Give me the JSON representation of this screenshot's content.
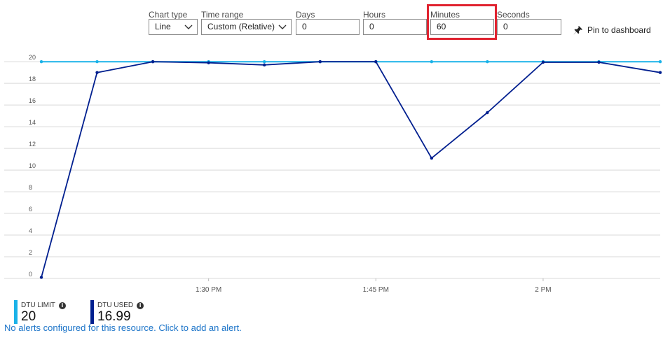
{
  "toolbar": {
    "chart_type": {
      "label": "Chart type",
      "value": "Line"
    },
    "time_range": {
      "label": "Time range",
      "value": "Custom (Relative)"
    },
    "days": {
      "label": "Days",
      "value": "0"
    },
    "hours": {
      "label": "Hours",
      "value": "0"
    },
    "minutes": {
      "label": "Minutes",
      "value": "60"
    },
    "seconds": {
      "label": "Seconds",
      "value": "0"
    },
    "pin_label": "Pin to dashboard"
  },
  "colors": {
    "dtu_limit": "#1ab2e8",
    "dtu_used": "#001f8f",
    "highlight": "#e0222f",
    "link": "#1a73c8",
    "grid": "#d9d9d9"
  },
  "chart_data": {
    "type": "line",
    "x_ticks": [
      "1:30 PM",
      "1:45 PM",
      "2 PM"
    ],
    "y_ticks": [
      "0",
      "2",
      "4",
      "6",
      "8",
      "10",
      "12",
      "14",
      "16",
      "18",
      "20"
    ],
    "ylim": [
      0,
      20.4
    ],
    "x_range_minutes": [
      0,
      55.5
    ],
    "tick_x_minutes": [
      15,
      30,
      45
    ],
    "grid": true,
    "legend_position": "bottom-left",
    "series": [
      {
        "name": "DTU LIMIT",
        "color": "#1ab2e8",
        "x": [
          0,
          5,
          10,
          15,
          20,
          25,
          30,
          35,
          40,
          45,
          50,
          55.5
        ],
        "values": [
          20,
          20,
          20,
          20,
          20,
          20,
          20,
          20,
          20,
          20,
          20,
          20
        ]
      },
      {
        "name": "DTU USED",
        "color": "#001f8f",
        "x": [
          0,
          5,
          10,
          15,
          20,
          25,
          30,
          35,
          40,
          45,
          50,
          55.5
        ],
        "values": [
          0.1,
          19.0,
          20.0,
          19.9,
          19.7,
          20.0,
          20.0,
          11.1,
          15.3,
          19.95,
          19.95,
          19.0
        ]
      }
    ]
  },
  "legend": [
    {
      "name": "DTU LIMIT",
      "value": "20",
      "color": "#1ab2e8"
    },
    {
      "name": "DTU USED",
      "value": "16.99",
      "color": "#001f8f"
    }
  ],
  "alert_text": "No alerts configured for this resource. Click to add an alert."
}
